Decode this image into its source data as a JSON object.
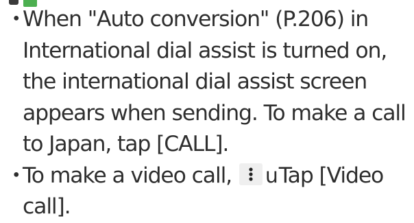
{
  "notes": {
    "item1": "When \"Auto conversion\" (P.206) in International dial assist is turned on, the international dial assist screen appears when sending. To make a call to Japan, tap [CALL].",
    "item2_before": "To make a video call,",
    "item2_arrow": "u",
    "item2_after": "Tap [Video call].",
    "bullet": "・"
  },
  "icons": {
    "menu_key": "more-options-icon"
  },
  "colors": {
    "text": "#2e2e2e",
    "accent_green": "#4caf50",
    "key_bg": "#efefef"
  }
}
